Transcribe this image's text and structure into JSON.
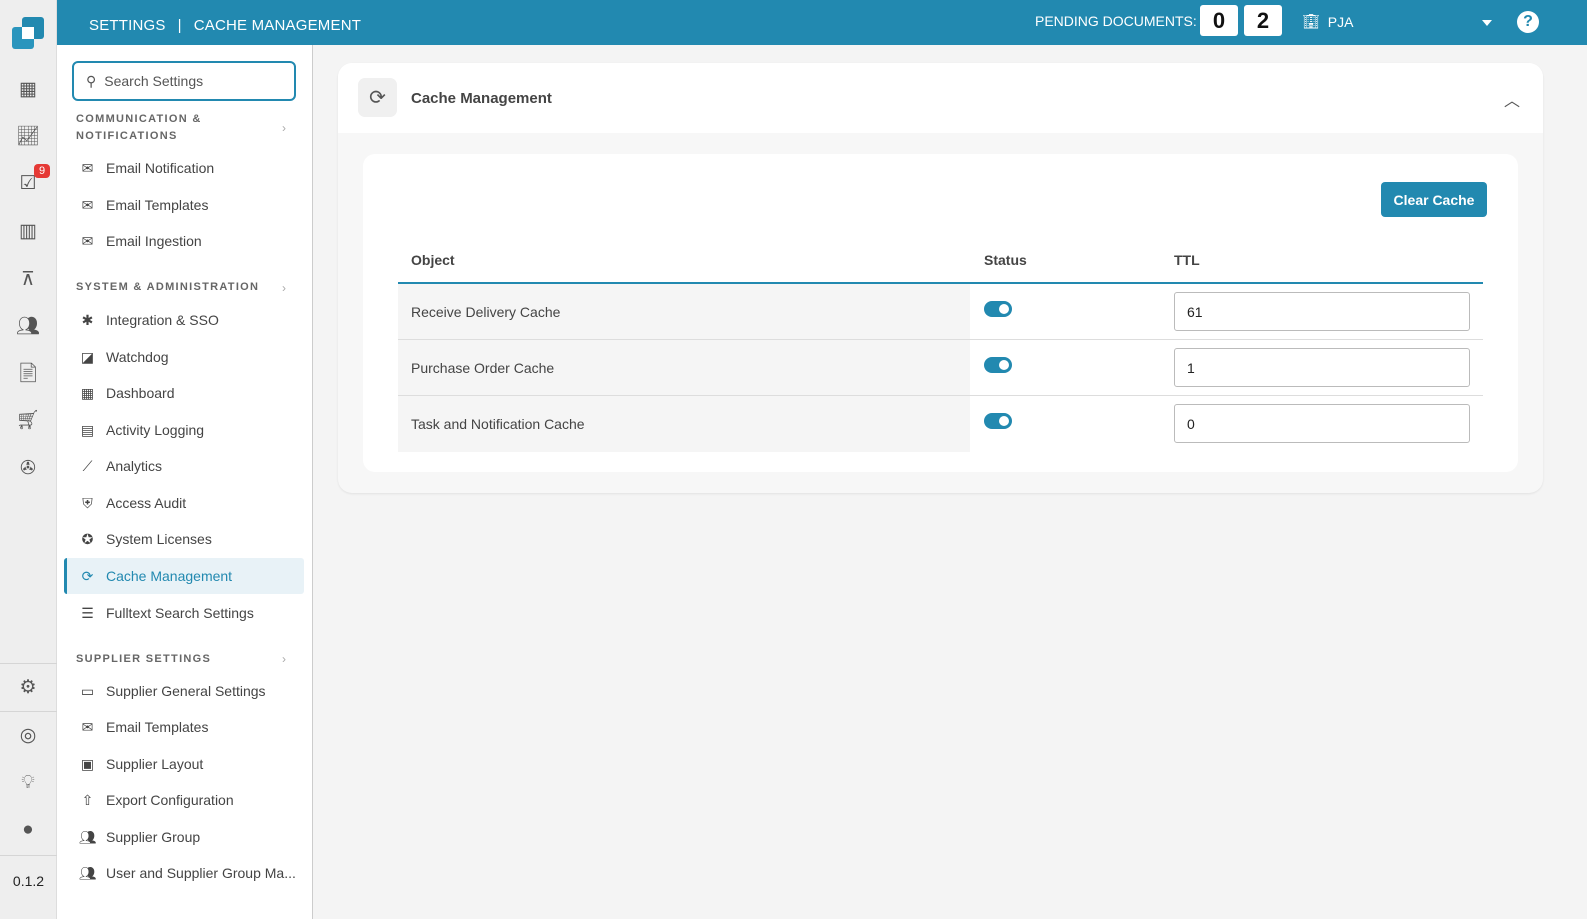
{
  "header": {
    "section": "SETTINGS",
    "page": "CACHE MANAGEMENT",
    "pending_label": "PENDING DOCUMENTS:",
    "pending_digits": [
      "0",
      "2"
    ],
    "org": "PJA"
  },
  "rail": {
    "badge": "9",
    "version": "0.1.2"
  },
  "sidebar": {
    "search_placeholder": "Search Settings",
    "sections": [
      {
        "title": "COMMUNICATION & NOTIFICATIONS",
        "items": [
          "Email Notification",
          "Email Templates",
          "Email Ingestion"
        ]
      },
      {
        "title": "SYSTEM & ADMINISTRATION",
        "items": [
          "Integration & SSO",
          "Watchdog",
          "Dashboard",
          "Activity Logging",
          "Analytics",
          "Access Audit",
          "System Licenses",
          "Cache Management",
          "Fulltext Search Settings"
        ]
      },
      {
        "title": "SUPPLIER SETTINGS",
        "items": [
          "Supplier General Settings",
          "Email Templates",
          "Supplier Layout",
          "Export Configuration",
          "Supplier Group",
          "User and Supplier Group Ma..."
        ]
      }
    ]
  },
  "panel": {
    "title": "Cache Management",
    "clear_label": "Clear Cache",
    "columns": [
      "Object",
      "Status",
      "TTL"
    ],
    "rows": [
      {
        "object": "Receive Delivery Cache",
        "status": true,
        "ttl": "61"
      },
      {
        "object": "Purchase Order Cache",
        "status": true,
        "ttl": "1"
      },
      {
        "object": "Task and Notification Cache",
        "status": true,
        "ttl": "0"
      }
    ]
  }
}
